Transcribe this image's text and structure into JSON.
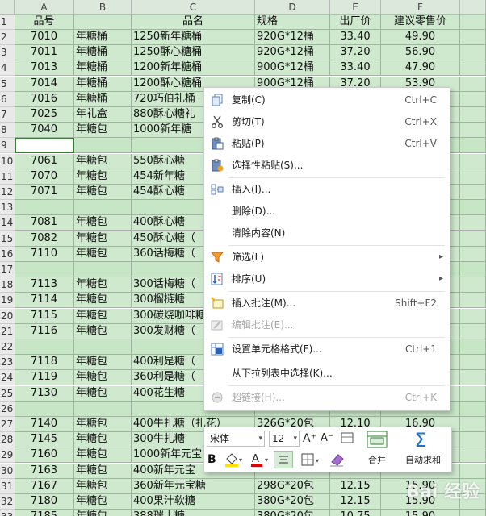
{
  "sheet": {
    "columns": [
      "A",
      "B",
      "C",
      "D",
      "E",
      "F"
    ],
    "header_row": {
      "num": "1",
      "a": "品号",
      "b": "",
      "c": "品名",
      "d": "规格",
      "e": "出厂价",
      "f": "建议零售价"
    },
    "rows": [
      {
        "num": "2",
        "a": "7010",
        "b": "年糖桶",
        "c": "1250新年糖桶",
        "d": "920G*12桶",
        "e": "33.40",
        "f": "49.90"
      },
      {
        "num": "3",
        "a": "7011",
        "b": "年糖桶",
        "c": "1250酥心糖桶",
        "d": "920G*12桶",
        "e": "37.20",
        "f": "56.90"
      },
      {
        "num": "4",
        "a": "7013",
        "b": "年糖桶",
        "c": "1200新年糖桶",
        "d": "900G*12桶",
        "e": "33.40",
        "f": "47.90"
      },
      {
        "num": "5",
        "a": "7014",
        "b": "年糖桶",
        "c": "1200酥心糖桶",
        "d": "900G*12桶",
        "e": "37.20",
        "f": "53.90"
      },
      {
        "num": "6",
        "a": "7016",
        "b": "年糖桶",
        "c": "720巧伯礼桶",
        "d": "",
        "e": "",
        "f": ""
      },
      {
        "num": "7",
        "a": "7025",
        "b": "年礼盒",
        "c": "880酥心糖礼",
        "d": "",
        "e": "",
        "f": ""
      },
      {
        "num": "8",
        "a": "7040",
        "b": "年糖包",
        "c": "1000新年糖",
        "d": "",
        "e": "",
        "f": ""
      },
      {
        "num": "9",
        "a": "",
        "b": "",
        "c": "",
        "d": "",
        "e": "",
        "f": ""
      },
      {
        "num": "10",
        "a": "7061",
        "b": "年糖包",
        "c": "550酥心糖",
        "d": "",
        "e": "",
        "f": ""
      },
      {
        "num": "11",
        "a": "7070",
        "b": "年糖包",
        "c": "454新年糖",
        "d": "",
        "e": "",
        "f": ""
      },
      {
        "num": "12",
        "a": "7071",
        "b": "年糖包",
        "c": "454酥心糖",
        "d": "",
        "e": "",
        "f": ""
      },
      {
        "num": "13",
        "a": "",
        "b": "",
        "c": "",
        "d": "",
        "e": "",
        "f": ""
      },
      {
        "num": "14",
        "a": "7081",
        "b": "年糖包",
        "c": "400酥心糖",
        "d": "",
        "e": "",
        "f": ""
      },
      {
        "num": "15",
        "a": "7082",
        "b": "年糖包",
        "c": "450酥心糖（",
        "d": "",
        "e": "",
        "f": ""
      },
      {
        "num": "16",
        "a": "7110",
        "b": "年糖包",
        "c": "360话梅糖（",
        "d": "",
        "e": "",
        "f": ""
      },
      {
        "num": "17",
        "a": "",
        "b": "",
        "c": "",
        "d": "",
        "e": "",
        "f": ""
      },
      {
        "num": "18",
        "a": "7113",
        "b": "年糖包",
        "c": "300话梅糖（",
        "d": "",
        "e": "",
        "f": ""
      },
      {
        "num": "19",
        "a": "7114",
        "b": "年糖包",
        "c": "300榴梿糖",
        "d": "",
        "e": "",
        "f": ""
      },
      {
        "num": "20",
        "a": "7115",
        "b": "年糖包",
        "c": "300碳烧咖啡糖",
        "d": "",
        "e": "",
        "f": ""
      },
      {
        "num": "21",
        "a": "7116",
        "b": "年糖包",
        "c": "300发财糖（",
        "d": "",
        "e": "",
        "f": ""
      },
      {
        "num": "22",
        "a": "",
        "b": "",
        "c": "",
        "d": "",
        "e": "",
        "f": ""
      },
      {
        "num": "23",
        "a": "7118",
        "b": "年糖包",
        "c": "400利是糖（",
        "d": "",
        "e": "",
        "f": ""
      },
      {
        "num": "24",
        "a": "7119",
        "b": "年糖包",
        "c": "360利是糖（",
        "d": "",
        "e": "",
        "f": ""
      },
      {
        "num": "25",
        "a": "7130",
        "b": "年糖包",
        "c": "400花生糖",
        "d": "",
        "e": "",
        "f": ""
      },
      {
        "num": "26",
        "a": "",
        "b": "",
        "c": "",
        "d": "",
        "e": "",
        "f": ""
      },
      {
        "num": "27",
        "a": "7140",
        "b": "年糖包",
        "c": "400牛扎糖（扎花）",
        "d": "326G*20包",
        "e": "12.10",
        "f": "16.90"
      },
      {
        "num": "28",
        "a": "7145",
        "b": "年糖包",
        "c": "300牛扎糖",
        "d": "",
        "e": "",
        "f": ""
      },
      {
        "num": "29",
        "a": "7160",
        "b": "年糖包",
        "c": "1000新年元宝",
        "d": "",
        "e": "",
        "f": ""
      },
      {
        "num": "30",
        "a": "7163",
        "b": "年糖包",
        "c": "400新年元宝",
        "d": "",
        "e": "",
        "f": ""
      },
      {
        "num": "31",
        "a": "7167",
        "b": "年糖包",
        "c": "360新年元宝糖",
        "d": "298G*20包",
        "e": "12.15",
        "f": "15.90"
      },
      {
        "num": "32",
        "a": "7180",
        "b": "年糖包",
        "c": "400果汁软糖",
        "d": "380G*20包",
        "e": "12.15",
        "f": "15.90"
      },
      {
        "num": "33",
        "a": "7185",
        "b": "年糖包",
        "c": "388瑞士糖",
        "d": "380G*20包",
        "e": "10.75",
        "f": "15.90"
      }
    ]
  },
  "context_menu": {
    "items": [
      {
        "label": "复制(C)",
        "shortcut": "Ctrl+C",
        "icon": "copy-icon",
        "enabled": true
      },
      {
        "label": "剪切(T)",
        "shortcut": "Ctrl+X",
        "icon": "scissors-icon",
        "enabled": true
      },
      {
        "label": "粘贴(P)",
        "shortcut": "Ctrl+V",
        "icon": "paste-icon",
        "enabled": true
      },
      {
        "label": "选择性粘贴(S)...",
        "shortcut": "",
        "icon": "paste-special-icon",
        "enabled": true
      },
      {
        "label": "插入(I)...",
        "shortcut": "",
        "icon": "insert-icon",
        "enabled": true
      },
      {
        "label": "删除(D)...",
        "shortcut": "",
        "icon": "",
        "enabled": true
      },
      {
        "label": "清除内容(N)",
        "shortcut": "",
        "icon": "",
        "enabled": true
      },
      {
        "label": "筛选(L)",
        "shortcut": "",
        "icon": "filter-icon",
        "enabled": true,
        "submenu": true
      },
      {
        "label": "排序(U)",
        "shortcut": "",
        "icon": "sort-icon",
        "enabled": true,
        "submenu": true
      },
      {
        "label": "插入批注(M)...",
        "shortcut": "Shift+F2",
        "icon": "comment-add-icon",
        "enabled": true
      },
      {
        "label": "编辑批注(E)...",
        "shortcut": "",
        "icon": "comment-edit-icon",
        "enabled": false
      },
      {
        "label": "设置单元格格式(F)...",
        "shortcut": "Ctrl+1",
        "icon": "format-cells-icon",
        "enabled": true
      },
      {
        "label": "从下拉列表中选择(K)...",
        "shortcut": "",
        "icon": "",
        "enabled": true
      },
      {
        "label": "超链接(H)...",
        "shortcut": "Ctrl+K",
        "icon": "hyperlink-icon",
        "enabled": false
      }
    ]
  },
  "mini_toolbar": {
    "font_name": "宋体",
    "font_size": "12",
    "grow_font": "A⁺",
    "shrink_font": "A⁻",
    "bold": "B",
    "merge_label": "合并",
    "autosum_label": "自动求和",
    "colors": {
      "fill": "#ffe000",
      "font": "#e00000",
      "accent": "#1a73c8"
    }
  },
  "watermark": "Bai 经验"
}
